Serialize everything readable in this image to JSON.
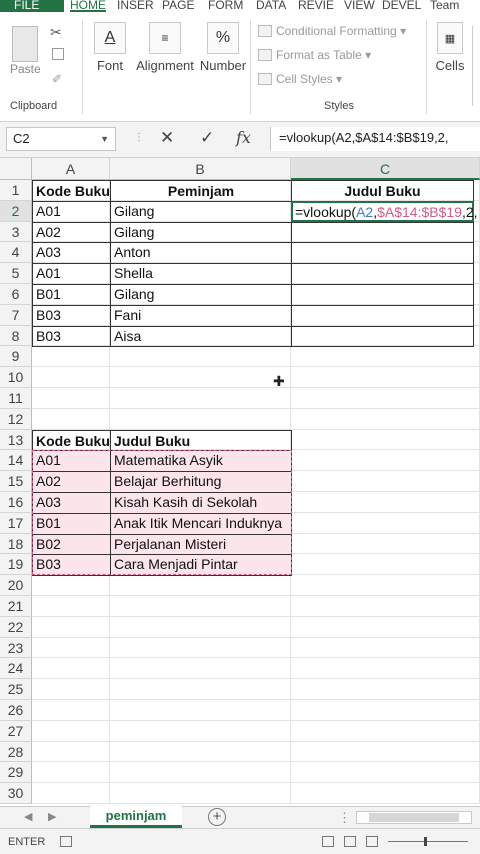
{
  "ribbon_tabs": [
    "FILE",
    "HOME",
    "INSER",
    "PAGE",
    "FORM",
    "DATA",
    "REVIE",
    "VIEW",
    "DEVEL",
    "Team"
  ],
  "active_tab": "HOME",
  "ribbon": {
    "paste": "Paste",
    "clipboard": "Clipboard",
    "font": "Font",
    "alignment": "Alignment",
    "number": "Number",
    "conditional_formatting": "Conditional Formatting",
    "format_as_table": "Format as Table",
    "cell_styles": "Cell Styles",
    "styles": "Styles",
    "cells": "Cells",
    "font_icon": "A",
    "number_icon": "%"
  },
  "name_box": "C2",
  "formula_bar": {
    "fx": "fx",
    "formula_prefix": "=vlookup(",
    "formula_a2": "A2",
    "formula_comma": ",",
    "formula_range": "$A$14:$B$19",
    "formula_suffix": ",2,"
  },
  "columns": [
    "A",
    "B",
    "C"
  ],
  "selected_column": "C",
  "row_numbers": [
    "1",
    "2",
    "3",
    "4",
    "5",
    "6",
    "7",
    "8",
    "9",
    "10",
    "11",
    "12",
    "13",
    "14",
    "15",
    "16",
    "17",
    "18",
    "19",
    "20",
    "21",
    "22",
    "23",
    "24",
    "25",
    "26",
    "27",
    "28",
    "29",
    "30"
  ],
  "selected_row": "2",
  "table1": {
    "headers": [
      "Kode Buku",
      "Peminjam",
      "Judul Buku"
    ],
    "rows": [
      [
        "A01",
        "Gilang"
      ],
      [
        "A02",
        "Gilang"
      ],
      [
        "A03",
        "Anton"
      ],
      [
        "A01",
        "Shella"
      ],
      [
        "B01",
        "Gilang"
      ],
      [
        "B03",
        "Fani"
      ],
      [
        "B03",
        "Aisa"
      ]
    ]
  },
  "table2": {
    "headers": [
      "Kode Buku",
      "Judul Buku"
    ],
    "rows": [
      [
        "A01",
        "Matematika Asyik"
      ],
      [
        "A02",
        "Belajar Berhitung"
      ],
      [
        "A03",
        "Kisah Kasih di Sekolah"
      ],
      [
        "B01",
        "Anak Itik Mencari Induknya"
      ],
      [
        "B02",
        "Perjalanan Misteri"
      ],
      [
        "B03",
        "Cara Menjadi Pintar"
      ]
    ]
  },
  "sheet_tab": "peminjam",
  "status_mode": "ENTER",
  "colors": {
    "accent": "#217346",
    "ref_a2": "#3d7bc2",
    "ref_range": "#d15a8a",
    "lookup_fill": "#fbe4ea"
  }
}
